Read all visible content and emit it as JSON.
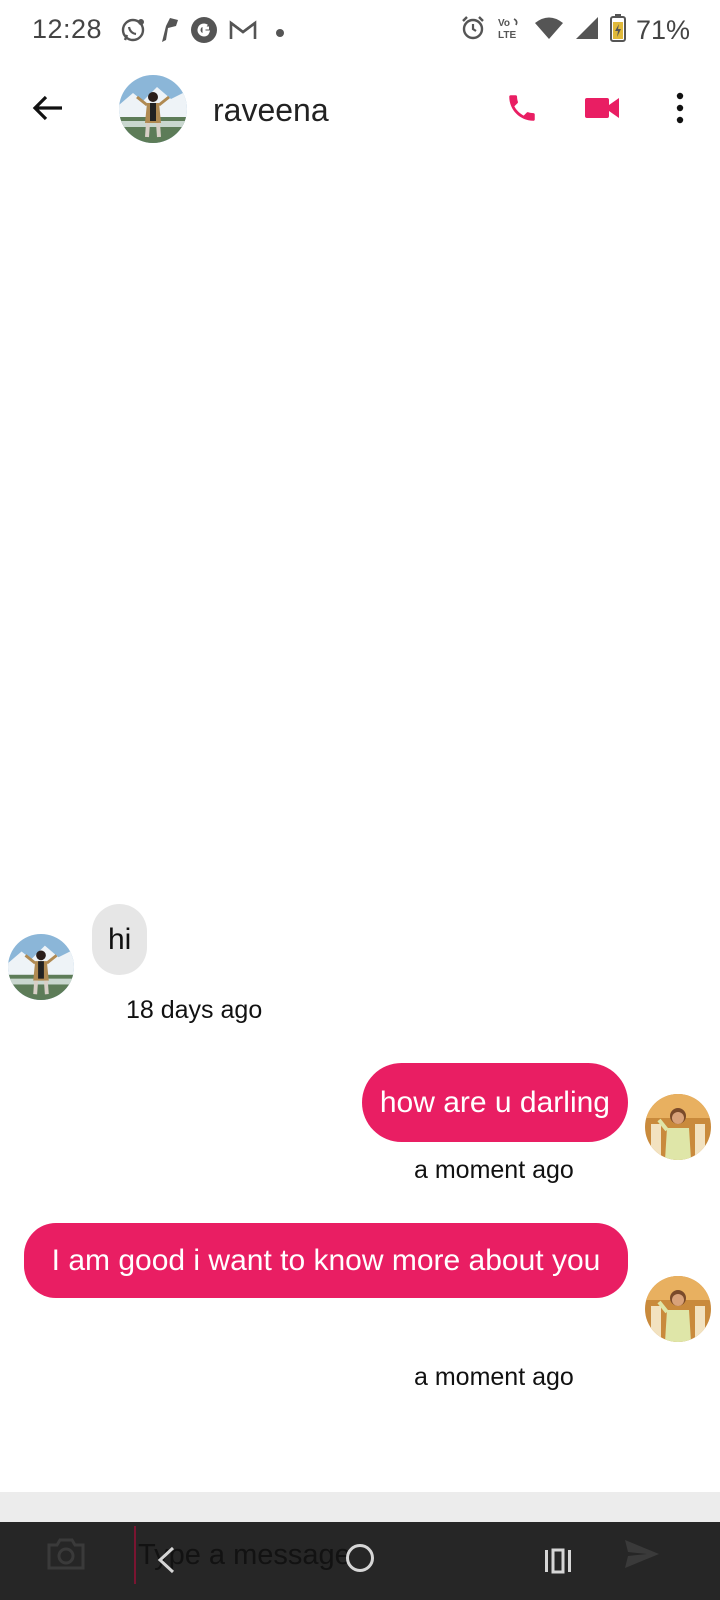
{
  "status_bar": {
    "time": "12:28",
    "battery": "71%",
    "network": "Vo LTE",
    "left_icons": [
      "whatsapp-icon",
      "tools-icon",
      "google-icon",
      "gmail-icon"
    ],
    "right_icons": [
      "alarm-icon",
      "volte-icon",
      "wifi-icon",
      "signal-icon",
      "battery-icon"
    ]
  },
  "header": {
    "contact_name": "raveena",
    "accent": "#e91e63"
  },
  "messages": [
    {
      "direction": "incoming",
      "text": "hi",
      "time": "18 days ago"
    },
    {
      "direction": "outgoing",
      "text": "how are u darling",
      "time": "a moment ago"
    },
    {
      "direction": "outgoing",
      "text": "I am good i want to know more about you",
      "time": "a moment ago"
    }
  ],
  "composer": {
    "placeholder": "Type a message",
    "value": ""
  },
  "colors": {
    "outgoing_bubble": "#e91e63",
    "incoming_bubble": "#e6e6e6",
    "composer_bg": "#262626"
  }
}
